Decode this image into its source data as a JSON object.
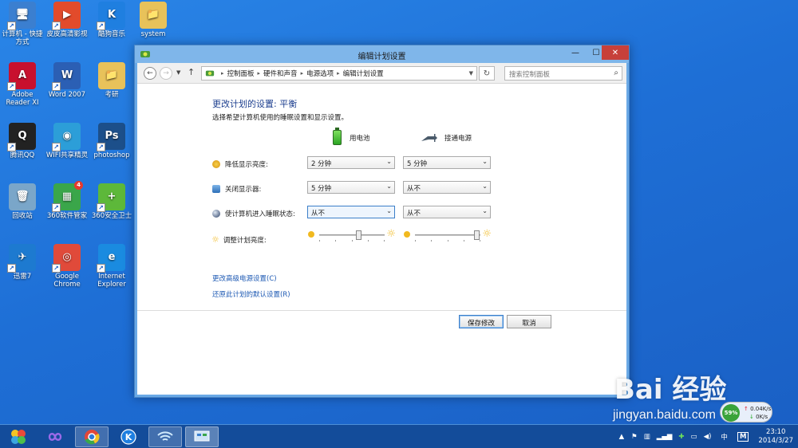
{
  "desktop": {
    "icons": [
      {
        "label": "计算机 - 快捷方式",
        "color": "#3b7fd0",
        "glyph": "🖥"
      },
      {
        "label": "皮皮高清影视",
        "color": "#e24b2b",
        "glyph": "▶"
      },
      {
        "label": "酷狗音乐",
        "color": "#1f7fe0",
        "glyph": "K"
      },
      {
        "label": "system",
        "color": "#e8c25a",
        "glyph": "📁"
      },
      {
        "label": "Adobe Reader XI",
        "color": "#c8102e",
        "glyph": "A"
      },
      {
        "label": "Word 2007",
        "color": "#2b5fb4",
        "glyph": "W"
      },
      {
        "label": "考研",
        "color": "#e8c25a",
        "glyph": "📁"
      },
      {
        "label": "腾讯QQ",
        "color": "#222222",
        "glyph": "Q"
      },
      {
        "label": "WIFI共享精灵",
        "color": "#2c9ed8",
        "glyph": "◉"
      },
      {
        "label": "photoshop",
        "color": "#1c4f8a",
        "glyph": "Ps"
      },
      {
        "label": "回收站",
        "color": "#7aa6c9",
        "glyph": "🗑"
      },
      {
        "label": "360软件管家",
        "color": "#3aa64a",
        "glyph": "▦"
      },
      {
        "label": "360安全卫士",
        "color": "#5db83a",
        "glyph": "+"
      },
      {
        "label": "迅雷7",
        "color": "#1d7ad0",
        "glyph": "✈"
      },
      {
        "label": "Google Chrome",
        "color": "#e04a3a",
        "glyph": "◎"
      },
      {
        "label": "Internet Explorer",
        "color": "#1a8be0",
        "glyph": "e"
      }
    ],
    "badge_360": "4"
  },
  "window": {
    "title": "编辑计划设置",
    "buttons": {
      "minimize": "—",
      "maximize": "☐",
      "close": "✕"
    },
    "breadcrumb": [
      "控制面板",
      "硬件和声音",
      "电源选项",
      "编辑计划设置"
    ],
    "search_placeholder": "搜索控制面板",
    "heading": "更改计划的设置: 平衡",
    "subheading": "选择希望计算机使用的睡眠设置和显示设置。",
    "columns": {
      "battery": "用电池",
      "plugged": "接通电源"
    },
    "rows": [
      {
        "label": "降低显示亮度:",
        "battery": "2 分钟",
        "plugged": "5 分钟"
      },
      {
        "label": "关闭显示器:",
        "battery": "5 分钟",
        "plugged": "从不"
      },
      {
        "label": "使计算机进入睡眠状态:",
        "battery": "从不",
        "plugged": "从不"
      }
    ],
    "brightness_label": "调整计划亮度:",
    "brightness": {
      "battery": 0.6,
      "plugged": 0.95
    },
    "links": {
      "advanced": "更改高级电源设置(C)",
      "restore": "还原此计划的默认设置(R)"
    },
    "save_button": "保存修改",
    "cancel_button": "取消"
  },
  "taskbar": {
    "time": "23:10",
    "date": "2014/3/27",
    "ime": "中",
    "ime2": "M"
  },
  "net_widget": {
    "percent": "59%",
    "up": "0.04K/s",
    "down": "0K/s"
  },
  "watermark": {
    "brand": "Bai 经验",
    "url": "jingyan.baidu.com"
  }
}
